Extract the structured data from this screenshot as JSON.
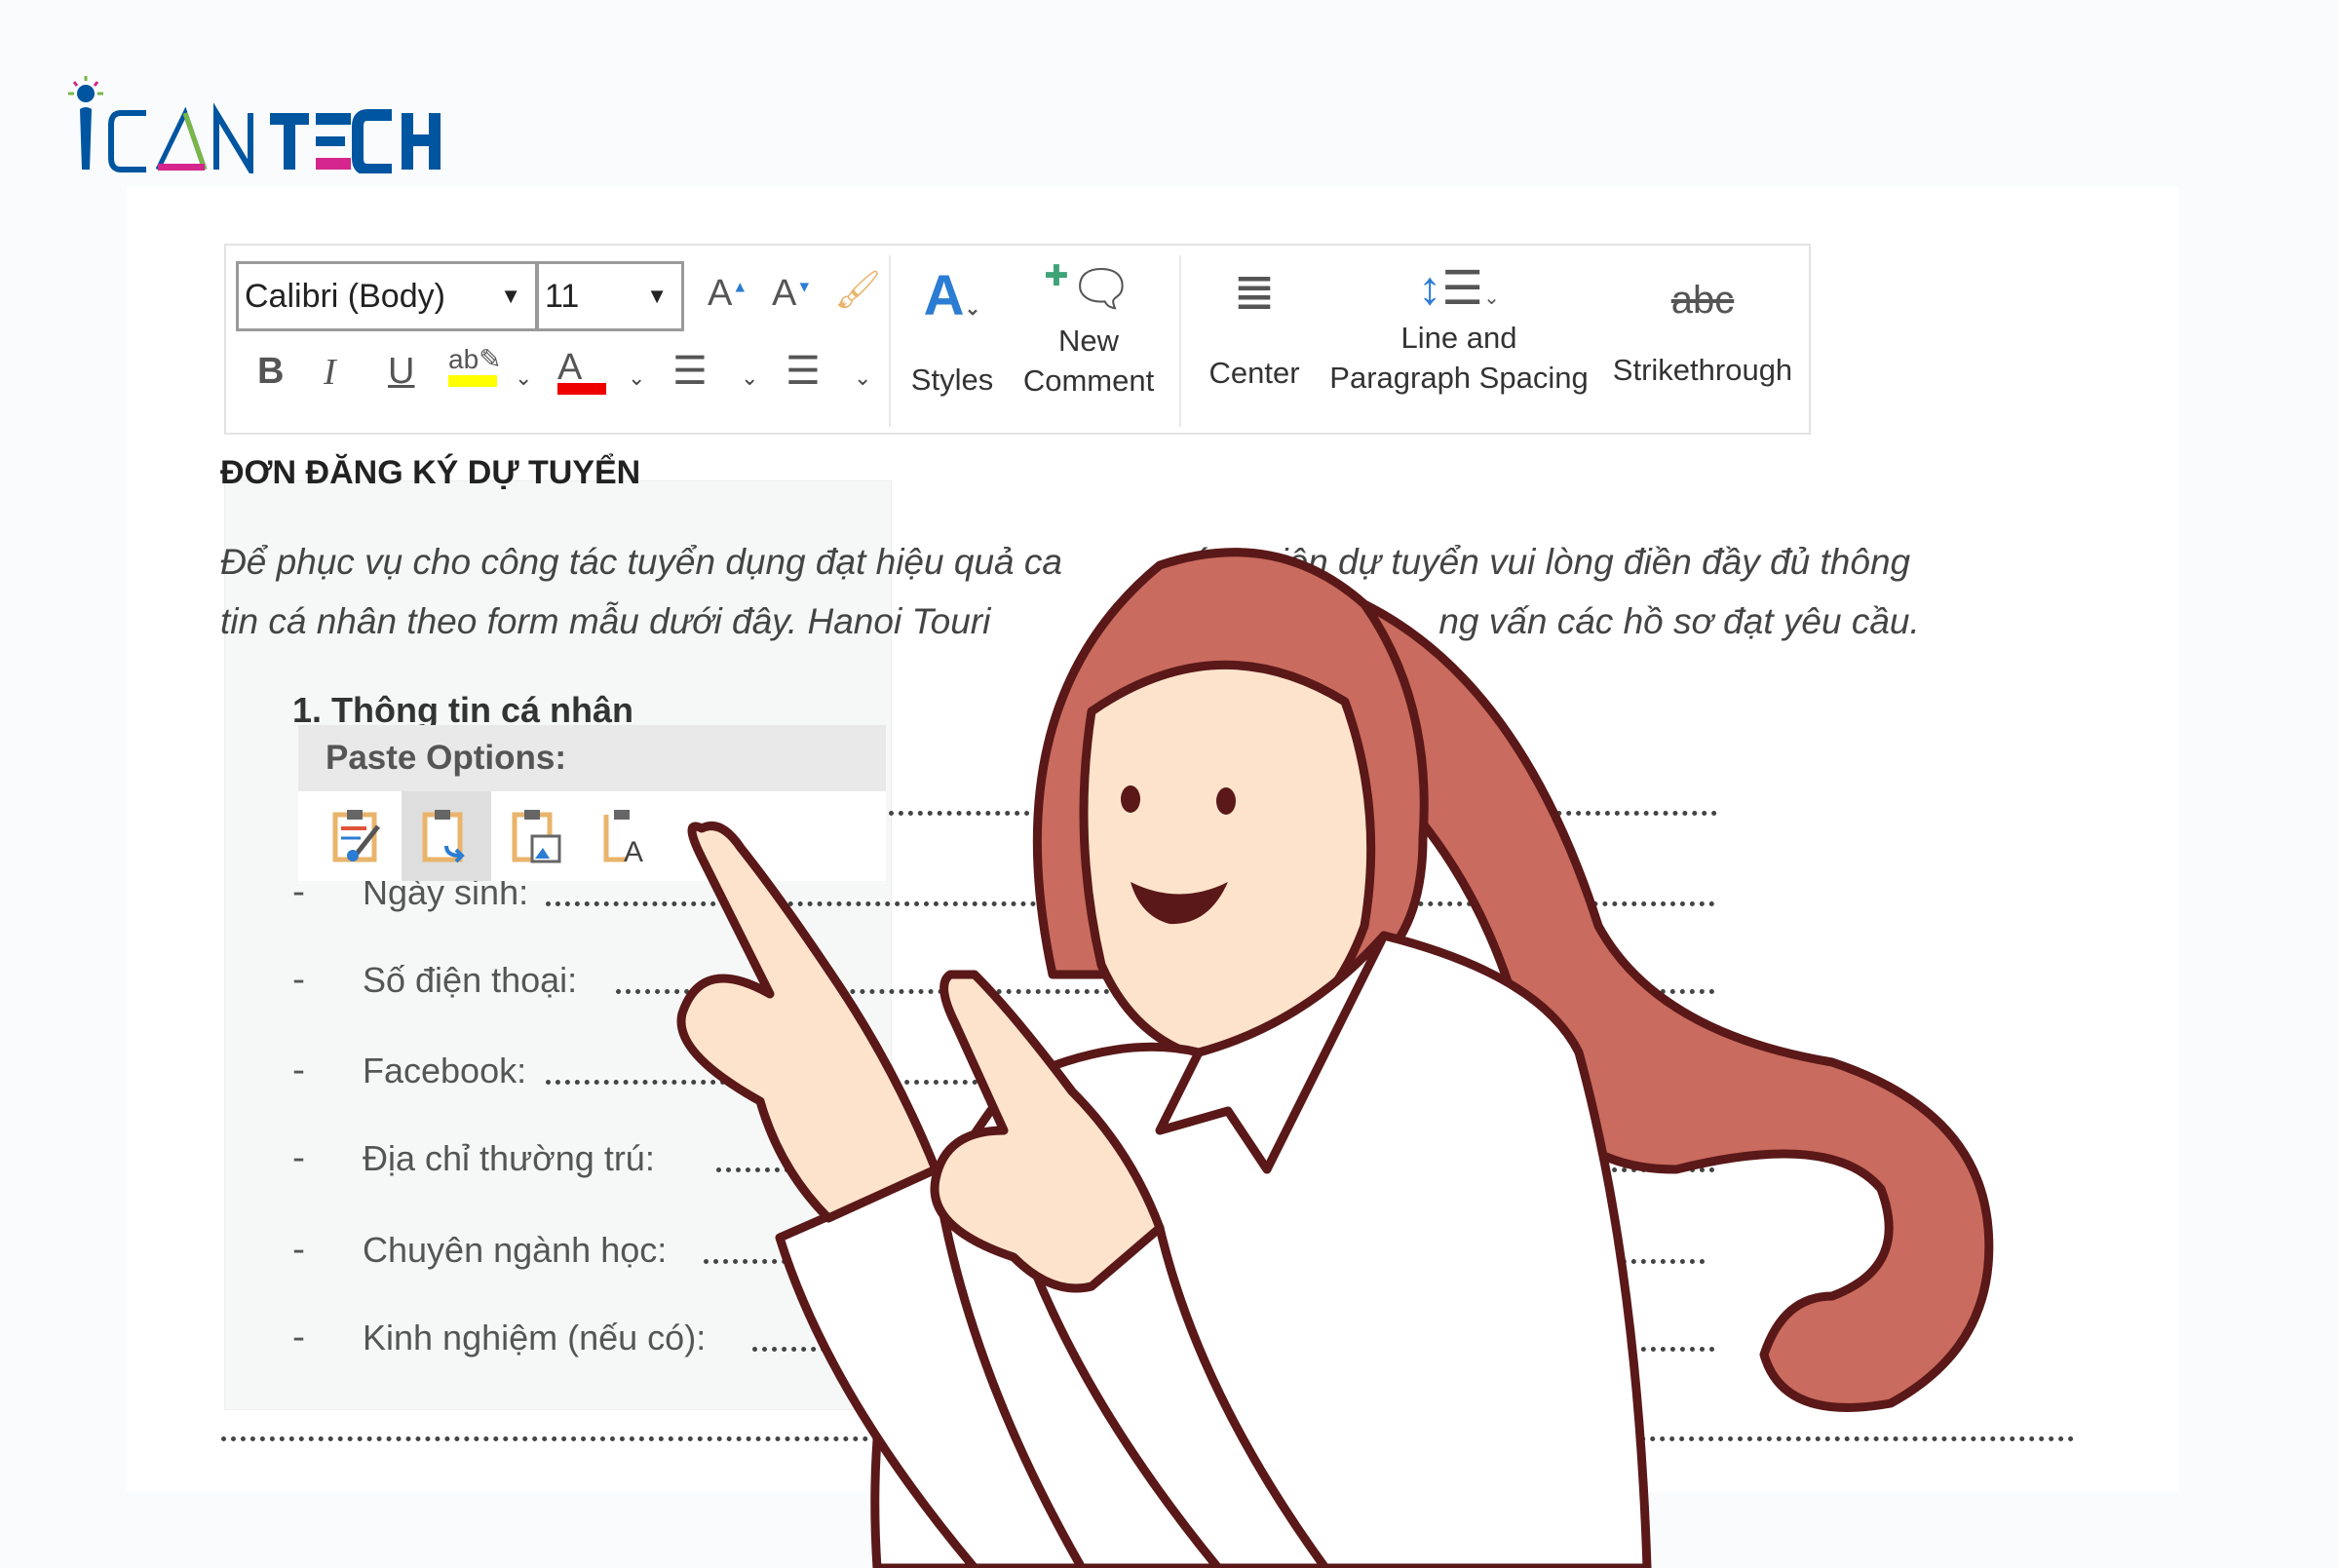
{
  "brand": {
    "logo_text": "iCANTECH",
    "colors": {
      "blue": "#0055a0",
      "pink": "#d4268c",
      "green": "#7ab648"
    }
  },
  "toolbar": {
    "font_name": "Calibri (Body)",
    "font_size": "11",
    "grow_font_icon": "font-grow-icon",
    "shrink_font_icon": "font-shrink-icon",
    "clear_format_icon": "format-painter-icon",
    "bold": "B",
    "italic": "I",
    "underline": "U",
    "highlight_color": "#ffff00",
    "font_color": "#ee0000",
    "styles_label": "Styles",
    "new_comment_label_1": "New",
    "new_comment_label_2": "Comment",
    "center_label": "Center",
    "spacing_label_1": "Line and",
    "spacing_label_2": "Paragraph Spacing",
    "strike_glyph": "abc",
    "strike_label": "Strikethrough"
  },
  "document": {
    "heading": "ĐƠN ĐĂNG KÝ DỰ TUYỂN",
    "para_line_1_a": "Để phục vụ cho công tác tuyển dụng đạt hiệu quả ca",
    "para_line_1_b": "ứng viên dự tuyển vui lòng điền đầy đủ thông",
    "para_line_2_a": "tin cá nhân theo form mẫu dưới đây. Hanoi Touri",
    "para_line_2_b": "ng vấn các hồ sơ đạt yêu cầu.",
    "section": "1.   Thông tin cá nhân",
    "fields": [
      {
        "dash": "-",
        "label": "Ngày sinh:"
      },
      {
        "dash": "-",
        "label": "Số điện thoại:"
      },
      {
        "dash": "-",
        "label": "Facebook:"
      },
      {
        "dash": "-",
        "label": "Địa chỉ thường trú:"
      },
      {
        "dash": "-",
        "label": "Chuyên ngành học:"
      },
      {
        "dash": "-",
        "label": "Kinh nghiệm (nếu có):"
      }
    ]
  },
  "paste_options": {
    "title": "Paste Options:",
    "icons": [
      "keep-source-formatting-icon",
      "merge-formatting-icon",
      "paste-picture-icon",
      "keep-text-only-icon"
    ],
    "active_index": 1
  },
  "illustration": {
    "hair": "#c96b5e",
    "outline": "#5a1818",
    "skin": "#fde3cc"
  }
}
